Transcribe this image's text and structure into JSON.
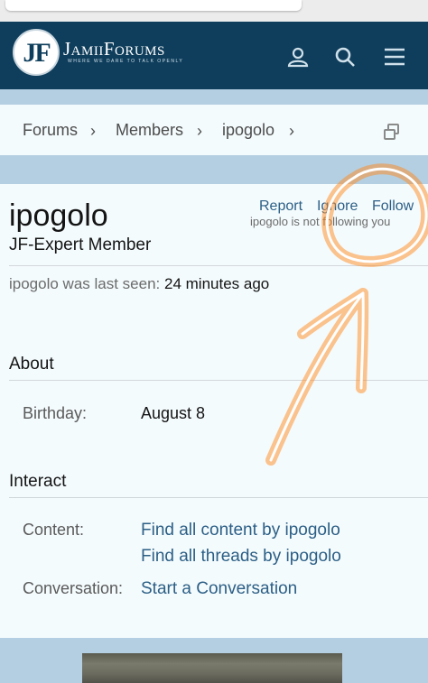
{
  "header": {
    "logo_letters": "JF",
    "logo_name": "JamiiForums",
    "logo_tagline": "WHERE WE DARE TO TALK OPENLY"
  },
  "breadcrumb": [
    "Forums",
    "Members",
    "ipogolo"
  ],
  "profile": {
    "username": "ipogolo",
    "user_title": "JF-Expert Member",
    "actions": {
      "report": "Report",
      "ignore": "Ignore",
      "follow": "Follow"
    },
    "follow_status": "ipogolo is not following you",
    "last_seen_label": "ipogolo was last seen:",
    "last_seen_value": "24 minutes ago"
  },
  "about": {
    "title": "About",
    "birthday_label": "Birthday:",
    "birthday_value": "August 8"
  },
  "interact": {
    "title": "Interact",
    "content_label": "Content:",
    "find_content": "Find all content by ipogolo",
    "find_threads": "Find all threads by ipogolo",
    "conversation_label": "Conversation:",
    "start_conversation": "Start a Conversation"
  },
  "colors": {
    "header_bg": "#0f3e5c",
    "band": "#b4cfe2",
    "link": "#2c5f86",
    "annotation": "#ff8a1e"
  },
  "icons": [
    "user-icon",
    "search-icon",
    "menu-icon",
    "chevron-right-icon",
    "copy-window-icon"
  ]
}
